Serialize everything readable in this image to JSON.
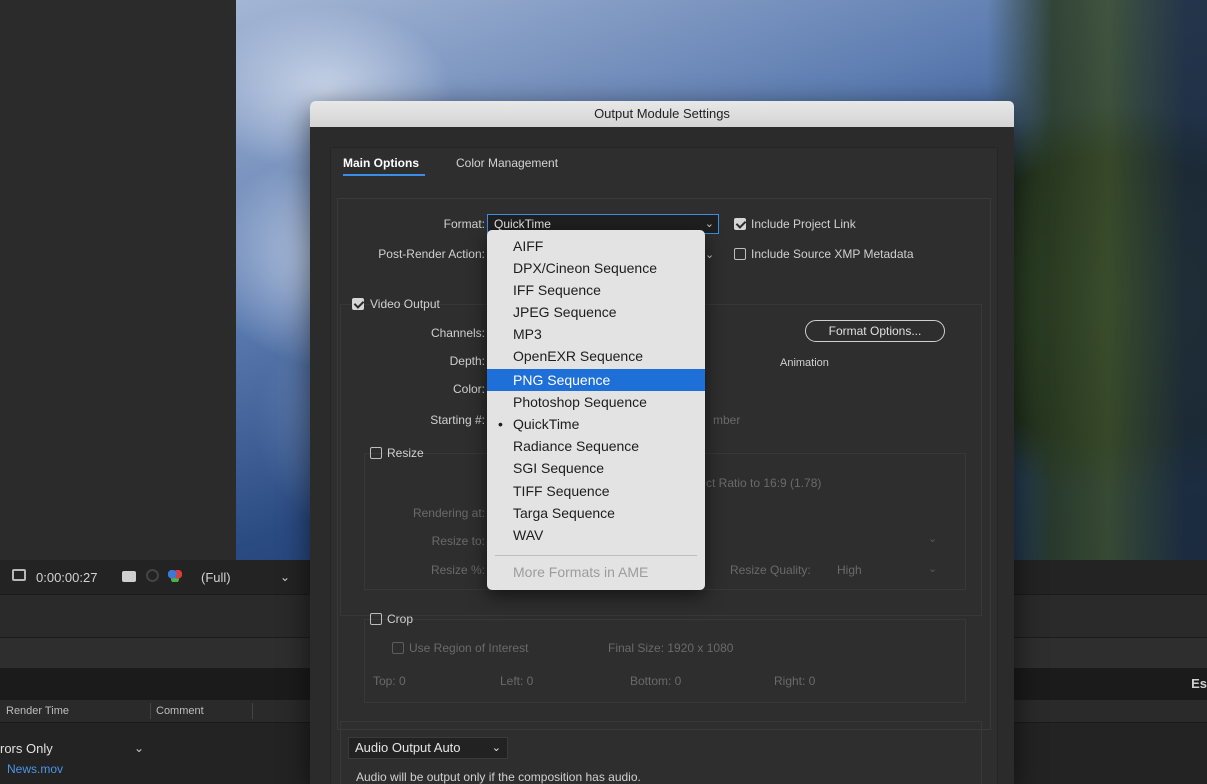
{
  "app": {
    "toolbar": {
      "timecode": "0:00:00:27",
      "resolution": "(Full)"
    },
    "band3_right_text": "Es",
    "render_queue": {
      "col_render_time": "Render Time",
      "col_comment": "Comment",
      "log_select": "rors Only",
      "output_file": "News.mov"
    }
  },
  "dialog": {
    "title": "Output Module Settings",
    "tabs": [
      "Main Options",
      "Color Management"
    ],
    "format_label": "Format:",
    "format_value": "QuickTime",
    "post_render_label": "Post-Render Action:",
    "include_project_link": "Include Project Link",
    "include_project_link_checked": true,
    "include_xmp": "Include Source XMP Metadata",
    "include_xmp_checked": false,
    "video_output": "Video Output",
    "video_output_checked": true,
    "channels_label": "Channels:",
    "depth_label": "Depth:",
    "color_label": "Color:",
    "starting_label": "Starting #:",
    "starting_suffix": "mber",
    "format_options": "Format Options...",
    "codec": "Animation",
    "resize": "Resize",
    "resize_checked": false,
    "aspect_text": "ct Ratio to 16:9 (1.78)",
    "rendering_at": "Rendering at:",
    "resize_to": "Resize to:",
    "resize_pct": "Resize %:",
    "resize_quality_label": "Resize Quality:",
    "resize_quality_value": "High",
    "crop": "Crop",
    "crop_checked": false,
    "use_roi": "Use Region of Interest",
    "final_size": "Final Size: 1920 x 1080",
    "top": "Top:  0",
    "left": "Left:  0",
    "bottom": "Bottom:  0",
    "right": "Right:  0",
    "audio_output": "Audio Output Auto",
    "audio_note": "Audio will be output only if the composition has audio."
  },
  "format_menu": {
    "items": [
      "AIFF",
      "DPX/Cineon Sequence",
      "IFF Sequence",
      "JPEG Sequence",
      "MP3",
      "OpenEXR Sequence",
      "PNG Sequence",
      "Photoshop Sequence",
      "QuickTime",
      "Radiance Sequence",
      "SGI Sequence",
      "TIFF Sequence",
      "Targa Sequence",
      "WAV"
    ],
    "highlighted": "PNG Sequence",
    "current": "QuickTime",
    "more": "More Formats in AME"
  },
  "colors": {
    "accent": "#1f6fd8",
    "tab_underline": "#3a8ee6",
    "link": "#4d94e6"
  }
}
